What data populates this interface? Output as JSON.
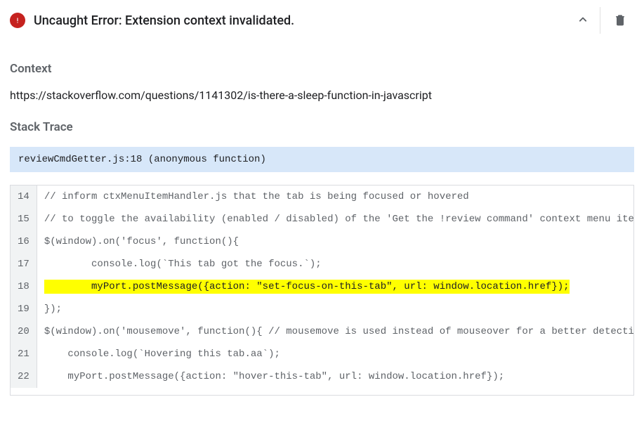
{
  "error": {
    "title": "Uncaught Error: Extension context invalidated."
  },
  "context": {
    "heading": "Context",
    "url": "https://stackoverflow.com/questions/1141302/is-there-a-sleep-function-in-javascript"
  },
  "stack": {
    "heading": "Stack Trace",
    "frame": "reviewCmdGetter.js:18 (anonymous function)"
  },
  "code": {
    "highlight_line": 18,
    "lines": [
      {
        "n": 14,
        "t": "// inform ctxMenuItemHandler.js that the tab is being focused or hovered"
      },
      {
        "n": 15,
        "t": "// to toggle the availability (enabled / disabled) of the 'Get the !review command' context menu item"
      },
      {
        "n": 16,
        "t": "$(window).on('focus', function(){"
      },
      {
        "n": 17,
        "t": "        console.log(`This tab got the focus.`);"
      },
      {
        "n": 18,
        "t": "        myPort.postMessage({action: \"set-focus-on-this-tab\", url: window.location.href});"
      },
      {
        "n": 19,
        "t": "});"
      },
      {
        "n": 20,
        "t": "$(window).on('mousemove', function(){ // mousemove is used instead of mouseover for a better detection"
      },
      {
        "n": 21,
        "t": "    console.log(`Hovering this tab.aa`);"
      },
      {
        "n": 22,
        "t": "    myPort.postMessage({action: \"hover-this-tab\", url: window.location.href});"
      }
    ]
  }
}
